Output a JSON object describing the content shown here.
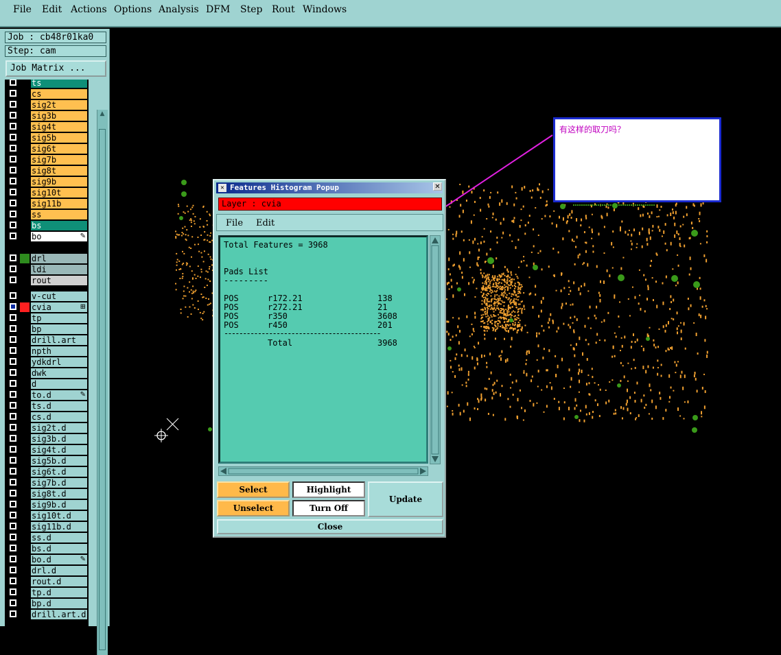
{
  "menubar": {
    "items": [
      "File",
      "Edit",
      "Actions",
      "Options",
      "Analysis",
      "DFM",
      "Step",
      "Rout",
      "Windows"
    ]
  },
  "left_panel": {
    "job": "Job : cb48r01ka0",
    "step": "Step: cam",
    "job_matrix": "Job Matrix ..."
  },
  "layers_group1": [
    {
      "name": "ts",
      "color": "#0f8f78",
      "text_color": "#fff"
    },
    {
      "name": "cs",
      "color": "#ffc050"
    },
    {
      "name": "sig2t",
      "color": "#ffc050"
    },
    {
      "name": "sig3b",
      "color": "#ffc050"
    },
    {
      "name": "sig4t",
      "color": "#ffc050"
    },
    {
      "name": "sig5b",
      "color": "#ffc050"
    },
    {
      "name": "sig6t",
      "color": "#ffc050"
    },
    {
      "name": "sig7b",
      "color": "#ffc050"
    },
    {
      "name": "sig8t",
      "color": "#ffc050"
    },
    {
      "name": "sig9b",
      "color": "#ffc050"
    },
    {
      "name": "sig10t",
      "color": "#ffc050"
    },
    {
      "name": "sig11b",
      "color": "#ffc050"
    },
    {
      "name": "ss",
      "color": "#ffc050"
    },
    {
      "name": "bs",
      "color": "#0f8f78",
      "text_color": "#fff"
    },
    {
      "name": "bo",
      "color": "#ffffff",
      "mark": "✎"
    }
  ],
  "layers_group2": [
    {
      "name": "drl",
      "color": "#9ab8b8",
      "swatch": "#2e8b1e"
    },
    {
      "name": "ldi",
      "color": "#9ab8b8"
    },
    {
      "name": "rout",
      "color": "#d0d0d0"
    }
  ],
  "layers_group3": [
    {
      "name": "v-cut",
      "color": "#9fd3d1"
    },
    {
      "name": "cvia",
      "color": "#9fd3d1",
      "swatch": "#ff2020",
      "active": true,
      "mark": "⊞"
    },
    {
      "name": "tp",
      "color": "#9fd3d1"
    },
    {
      "name": "bp",
      "color": "#9fd3d1"
    },
    {
      "name": "drill.art",
      "color": "#9fd3d1"
    },
    {
      "name": "npth",
      "color": "#9fd3d1"
    },
    {
      "name": "ydkdrl",
      "color": "#9fd3d1"
    },
    {
      "name": "dwk",
      "color": "#9fd3d1"
    },
    {
      "name": "d",
      "color": "#9fd3d1"
    },
    {
      "name": "to.d",
      "color": "#9fd3d1",
      "mark": "✎"
    },
    {
      "name": "ts.d",
      "color": "#9fd3d1"
    },
    {
      "name": "cs.d",
      "color": "#9fd3d1"
    },
    {
      "name": "sig2t.d",
      "color": "#9fd3d1"
    },
    {
      "name": "sig3b.d",
      "color": "#9fd3d1"
    },
    {
      "name": "sig4t.d",
      "color": "#9fd3d1"
    },
    {
      "name": "sig5b.d",
      "color": "#9fd3d1"
    },
    {
      "name": "sig6t.d",
      "color": "#9fd3d1"
    },
    {
      "name": "sig7b.d",
      "color": "#9fd3d1"
    },
    {
      "name": "sig8t.d",
      "color": "#9fd3d1"
    },
    {
      "name": "sig9b.d",
      "color": "#9fd3d1"
    },
    {
      "name": "sig10t.d",
      "color": "#9fd3d1"
    },
    {
      "name": "sig11b.d",
      "color": "#9fd3d1"
    },
    {
      "name": "ss.d",
      "color": "#9fd3d1"
    },
    {
      "name": "bs.d",
      "color": "#9fd3d1"
    },
    {
      "name": "bo.d",
      "color": "#9fd3d1",
      "mark": "✎"
    },
    {
      "name": "drl.d",
      "color": "#9fd3d1"
    },
    {
      "name": "rout.d",
      "color": "#9fd3d1"
    },
    {
      "name": "tp.d",
      "color": "#9fd3d1"
    },
    {
      "name": "bp.d",
      "color": "#9fd3d1"
    },
    {
      "name": "drill.art.d",
      "color": "#9fd3d1"
    }
  ],
  "popup": {
    "title": "Features Histogram Popup",
    "layer_label": "Layer :  cvia",
    "menu": {
      "file": "File",
      "edit": "Edit"
    },
    "total_features": "Total Features = 3968",
    "section_title": "Pads List",
    "section_rule": "---------",
    "rows": [
      {
        "pol": "POS",
        "sym": "r172.21",
        "count": "138"
      },
      {
        "pol": "POS",
        "sym": "r272.21",
        "count": "21"
      },
      {
        "pol": "POS",
        "sym": "r350",
        "count": "3608"
      },
      {
        "pol": "POS",
        "sym": "r450",
        "count": "201"
      }
    ],
    "total_rule": "------------------------------------------",
    "total_label": "Total",
    "total_value": "3968",
    "buttons": {
      "select": "Select",
      "highlight": "Highlight",
      "update": "Update",
      "unselect": "Unselect",
      "turn_off": "Turn Off",
      "close": "Close"
    }
  },
  "note": {
    "text": "有这样的取刀吗？"
  },
  "colors": {
    "panel_teal": "#9fd3d1",
    "pad_orange": "#f0a030",
    "pad_green": "#3a9a1a",
    "annotation_magenta": "#e020e0",
    "note_border": "#1b2bd0"
  }
}
